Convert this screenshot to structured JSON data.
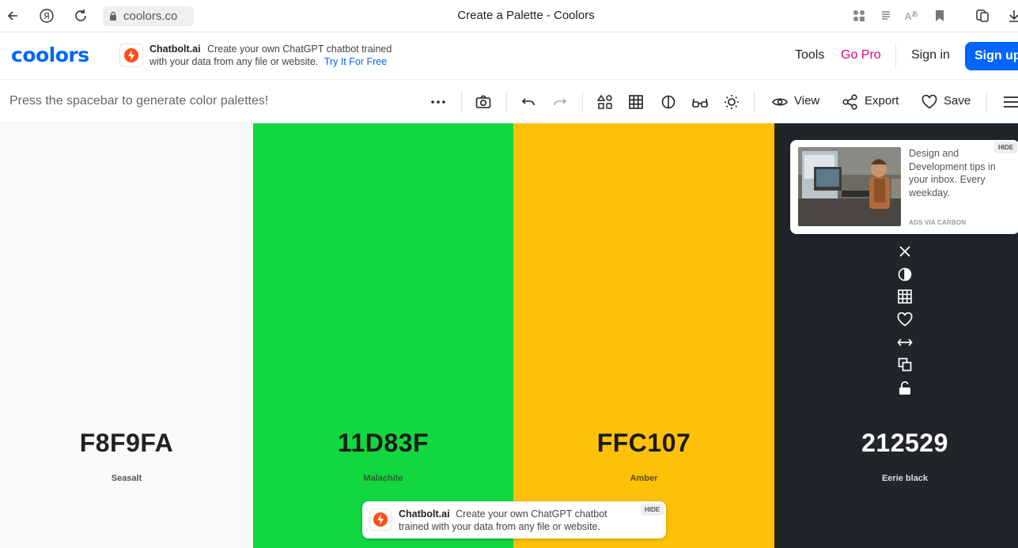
{
  "browser": {
    "url": "coolors.co",
    "title": "Create a Palette - Coolors"
  },
  "header": {
    "logo": "coolors",
    "promo": {
      "brand": "Chatbolt.ai",
      "text": "Create your own ChatGPT chatbot trained with your data from any file or website.",
      "link": "Try It For Free"
    },
    "nav": {
      "tools": "Tools",
      "go_pro": "Go Pro",
      "sign_in": "Sign in",
      "sign_up": "Sign up"
    }
  },
  "toolbar": {
    "hint": "Press the spacebar to generate color palettes!",
    "more": "···",
    "view": "View",
    "export": "Export",
    "save": "Save"
  },
  "palette": {
    "colors": [
      {
        "hex": "F8F9FA",
        "name": "Seasalt",
        "color": "#F8F9FA",
        "text_color": "#222222",
        "name_color": "#555555"
      },
      {
        "hex": "11D83F",
        "name": "Malachite",
        "color": "#11D83F",
        "text_color": "#1a1a1a",
        "name_color": "#2f5a35"
      },
      {
        "hex": "FFC107",
        "name": "Amber",
        "color": "#FFC107",
        "text_color": "#1a1a1a",
        "name_color": "#5a4a20"
      },
      {
        "hex": "212529",
        "name": "Eerie black",
        "color": "#212529",
        "text_color": "#ffffff",
        "name_color": "#dddddd"
      }
    ]
  },
  "carbon_ad": {
    "text": "Design and Development tips in your inbox. Every weekday.",
    "via": "ADS VIA CARBON",
    "hide": "HIDE"
  },
  "bottom_ad": {
    "brand": "Chatbolt.ai",
    "text": "Create your own ChatGPT chatbot trained with your data from any file or website.",
    "hide": "HIDE"
  },
  "colors": {
    "brand_blue": "#0066ff",
    "go_pro_pink": "#e6007e"
  }
}
